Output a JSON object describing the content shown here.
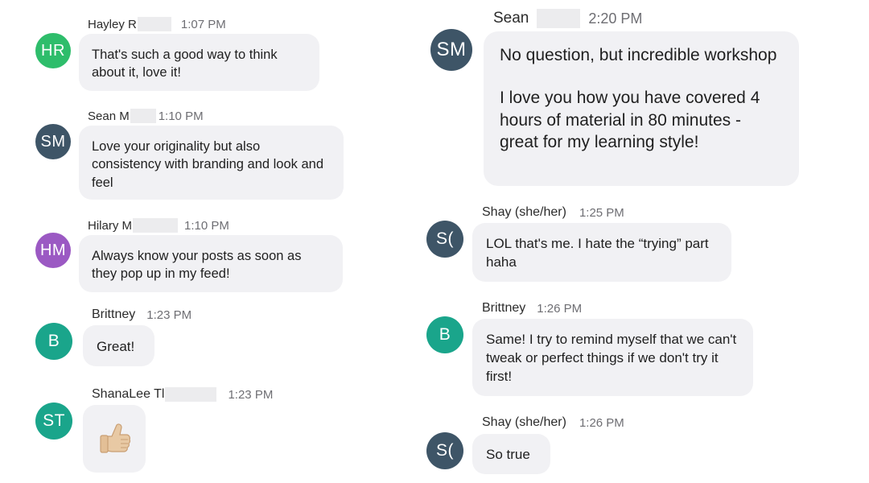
{
  "colors": {
    "bubble_bg": "#f1f1f4",
    "redaction": "#ececee",
    "avatar_green": "#2ebd6b",
    "avatar_slate": "#3e5567",
    "avatar_purple": "#9b59c3",
    "avatar_teal": "#1aa58b"
  },
  "left_messages": [
    {
      "initials": "HR",
      "sender": "Hayley R",
      "time": "1:07 PM",
      "text": "That's such a good way to think about it, love it!"
    },
    {
      "initials": "SM",
      "sender": "Sean M",
      "time": "1:10 PM",
      "text": "Love your originality but also consistency with branding and look and feel"
    },
    {
      "initials": "HM",
      "sender": "Hilary M",
      "time": "1:10 PM",
      "text": "Always know your posts as soon as they pop up in my feed!"
    },
    {
      "initials": "B",
      "sender": "Brittney",
      "time": "1:23 PM",
      "text": "Great!"
    },
    {
      "initials": "ST",
      "sender": "ShanaLee Tl",
      "time": "1:23 PM",
      "emoji": "thumbs-up",
      "text": ""
    }
  ],
  "right_messages": [
    {
      "initials": "SM",
      "sender": "Sean",
      "time": "2:20 PM",
      "text": "No question, but incredible workshop",
      "text2": "I love you how you have covered 4 hours of material in 80 minutes - great for my learning style!"
    },
    {
      "initials": "S(",
      "sender": "Shay (she/her)",
      "time": "1:25 PM",
      "text": "LOL that's me. I hate the “trying” part haha"
    },
    {
      "initials": "B",
      "sender": "Brittney",
      "time": "1:26 PM",
      "text": "Same! I try to remind myself that we can't tweak or perfect things if we don't try it first!"
    },
    {
      "initials": "S(",
      "sender": "Shay (she/her)",
      "time": "1:26 PM",
      "text": "So true"
    }
  ]
}
